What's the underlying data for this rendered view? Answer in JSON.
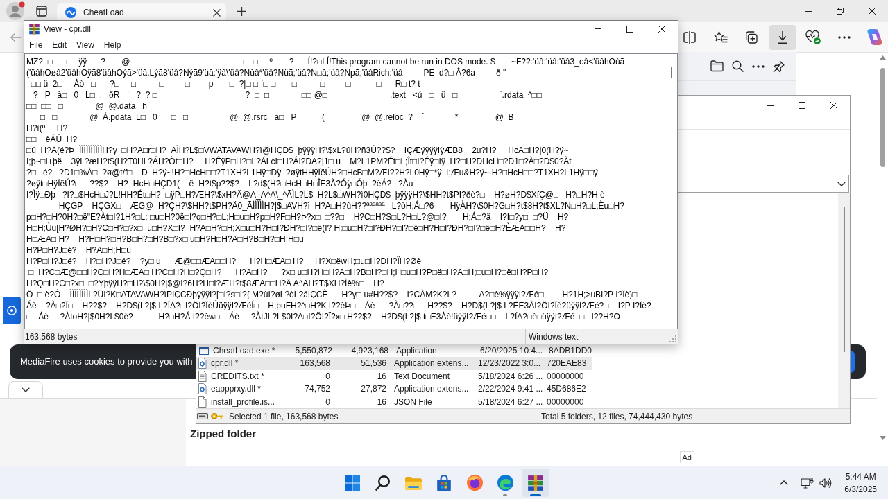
{
  "browser": {
    "tabs": [
      {
        "title": "CheatLoad",
        "selected": true
      }
    ],
    "downloads_panel_open": true
  },
  "page": {
    "cookie_banner": {
      "text": "MediaFire uses cookies to provide you with"
    },
    "file_type": "Zipped folder",
    "ad_label": "Ad"
  },
  "archive_window": {
    "files": [
      {
        "name": "CheatLoad.exe *",
        "size": "5,550,872",
        "packed": "4,923,168",
        "type": "Application",
        "modified": "6/20/2025 10:4...",
        "crc": "8ADB1DD0",
        "kind": "exe",
        "selected": false
      },
      {
        "name": "cpr.dll *",
        "size": "163,568",
        "packed": "51,536",
        "type": "Application extens...",
        "modified": "12/23/2022 3:0...",
        "crc": "720EAE83",
        "kind": "dll",
        "selected": true
      },
      {
        "name": "CREDITS.txt *",
        "size": "0",
        "packed": "16",
        "type": "Text Document",
        "modified": "5/18/2024 6:26 ...",
        "crc": "00000000",
        "kind": "txt",
        "selected": false
      },
      {
        "name": "eappprxy.dll *",
        "size": "74,752",
        "packed": "27,872",
        "type": "Application extens...",
        "modified": "2/22/2024 9:41 ...",
        "crc": "45D686E2",
        "kind": "dll",
        "selected": false
      },
      {
        "name": "install_profile.is...",
        "size": "0",
        "packed": "16",
        "type": "JSON File",
        "modified": "5/18/2024 6:27 ...",
        "crc": "00000000",
        "kind": "json",
        "selected": false
      }
    ],
    "status": {
      "selection": "Selected 1 file, 163,568 bytes",
      "total": "Total 5 folders, 12 files, 74,444,430 bytes"
    }
  },
  "viewer_window": {
    "title": "View - cpr.dll",
    "menu": [
      "File",
      "Edit",
      "View",
      "Help"
    ],
    "lines": [
      "MZ?  □    □     ÿÿ      ?       @                                                 □  □     º□     ?      Í!?□LÍ!This program cannot be run in DOS mode. $       ~F??:'üâ:'üâ:'üâ3_oâ<'üâhOùã",
      "('üâhOøâ2'üâhOÿã8'üâhOýã>'üâ.Lýã8'üâ?Nýã9'üâ:'ÿâ\\'üâ?Nùâ*'üâ?Nüã;'üâ?N□â;'üâ?Npã;'üâRich:'üâ         PE  d?□ Â?6a         ð \"",
      "  □□ ü  2□     Àò   □      ?□     □          □         □        p       □  ?|□ □ `□ □       □          □         □           □      R□ t? t",
      "   ?   P   à□   0   L□  ,   ðR   `   ?  ? □                                      ?  □  □              □□ @□                           .text   <ú   □   ü   □                  `.rdata  ^□□",
      "□□  □□   □              @  @.data   h",
      "      □   □              @  À.pdata  L□   0      □   □                  @  @.rsrc   à□   P           (                @  @.reloc  ?    `             *                @  B",
      "H?ì(º     H?",
      "□□    èÁÙ  H?",
      "□ú  H?Ä(é?Þ  ÌÌÌÌÌÌÌÌÌÌH?y  □H?A□r□H?  ÃÌH?L$□VWATAVAWH?ì@HÇD$  þÿÿÿH?\\$xL?úH?ñ3Û??$?    IÇÆÿÿÿÿIÿÆB8    2u?H?     HcA□H?|0(H?ÿ~",
      "I;þ~□I+þë    3ÿL?æH?t$(H?T0HL?ÁH?Òt□H?     H?ÊÿP□H?□L?ÁLcI□H?ÁI?ÐA?|1□ u    M?L1PM?Ét□L;Ît□I?Éÿ□Iÿ  H?□H?ÐHcH□?D1□?À□?D$0?Àt",
      "?□   é?   ?D1□%À□  ?ø@t/f□    D  H?ÿ~!H?□HcH□□?T1XH?L1Hÿ□Dÿ  ?øÿtHHÿÏëÚH?□HcB□M?ÆI??H?L0Hÿ□*ÿ  I;Æu&H?ÿ~-H?□HcH□□?T1XH?L1Hÿ□□ÿ",
      "?øÿt□HÿÏëÚ?□    ??$?    H?□HcH□HÇD1(    ë□H?t$p??$?    L?d$(H?□HcH□H□ÎE3À?Óÿ□Óþ  ?èÁ?   ?Àu",
      "I?Ìÿ□Ðþ   ?I?□$HcH□J?L!HH?Ét□H?  □ÿP□H?ÆH?\\$xH?Ä@A_A^A\\_^ÃÌL?L$  H?L$□WH?ì0HÇD$  þÿÿÿH?\\$HH?t$PI?ðè?□    H?øH?D$XfÇ@□   H?□H?H è",
      "              HÇGP    HÇGX□    ÆG@  H?ÇH?\\$HH?t$PH?Ä0_ÃÌÌÌÌÌH?|$□AVH?ì  H?A□H?ùH??ªªªªªª   L?òH;Á□?6       HÿÀH?\\$0H?G□H?t$8H?t$XL?N□H?□L;Èu□H?",
      "p□H?□H?0H?□ë\"E?Àt□I?1H?□L; □u□H?0ë□I?q□H?□L;H□u□H?p□H?F□H?Þ?x□  □??□    H?C□H?S□L?H□L?@□I?       H;Á□?ä    I?I□?y□  □?Ü    H?",
      "H□H;Ùu[H?ØH?□H?C□H?□?x□  u□H?X□I?  H?A□H?□H;X□u□H?H□I?ÐH?□I?□ë(I? H;□u□H?□I?ÐH?□I?□ë□H?H□I?ÐH?□I?□ë□H?ÈÆA□□H?    H?",
      "H□ÆA□ H?    H?H□H?□H?B□H?□H?B□?x□ u□H?H□H?A□H?B□H?□H;H□u",
      "H?P□H?J□é?    H?A□H;H□u",
      "H?P□H?J□é?    H?□H?J□é?    ?y□ u      Æ@□□ÆA□□H?      H?H□ÆA□ H?     H?X□ëwH;□u□H?ÐH?ÏH?Øè",
      " □  H?C□Æ@□□H?C□H?H□ÆA□ H?C□H?H□?Q□H?      H?A□H?      ?x□ u□H?H□H?A□H?B□H?□H;H□u□H?P□ë□H?A□H;□u□H?□ë□H?P□H?",
      "H?Q□H?C□?x□  □?YþÿÿH?□H?\\$0H?|$@I?6H?H□I?ÆH?t$8ÆA□□H?Ä A^ÃH?T$XH?Ìè%□    H?",
      "Ö  □ è?Ô    ÌÌÌÌÌÌÌÌL?ÜI?K□ATAVAWH?ìPIÇCÐþÿÿÿI?[□I?s□I?{ M?ùI?øL?òL?áIÇCÈ      H?y□ u#H??$?    I?CÀM?K?L?          A?□è%ÿÿÿI?Æé□        H?1H;>uBI?P I?Ïè)□",
      "Áè    ?À□?Ï□    H??$?    H?D$(L?|$ L?ÏA?□I?ÖI?ÏèÛüÿÿI?ÆéÍ□    H;þuFH?^□H?K I??èÞ□    Áè      ?À□??□    H??$?    H?D$(L?|$ L?ËE3ÀI?ÖI?Ïè?üÿÿI?Æé?□    I?P I?Ïè?",
      "□   Áè     ?ÀtoH?|$0H?L$0è?           H?□H?Á I??èw□    Áè     ?ÀtJL?L$0I?A□I?ÖI?Ï?x□ H??$?    H?D$(L?|$ t□E3Àè!üÿÿI?Æé□□    L?ÏA?□è□üÿÿI?Æé  □   I??H?O"
    ],
    "status": {
      "size": "163,568 bytes",
      "encoding": "Windows text"
    }
  },
  "taskbar": {
    "apps": [
      {
        "kind": "start",
        "running": false,
        "selected": false
      },
      {
        "kind": "search",
        "running": false,
        "selected": false
      },
      {
        "kind": "explorer",
        "running": false,
        "selected": false
      },
      {
        "kind": "store",
        "running": false,
        "selected": false
      },
      {
        "kind": "firefox",
        "running": false,
        "selected": false
      },
      {
        "kind": "edge",
        "running": true,
        "selected": false
      },
      {
        "kind": "winrar",
        "running": true,
        "selected": true
      }
    ],
    "clock": {
      "time": "5:44 AM",
      "date": "6/3/2025"
    }
  }
}
